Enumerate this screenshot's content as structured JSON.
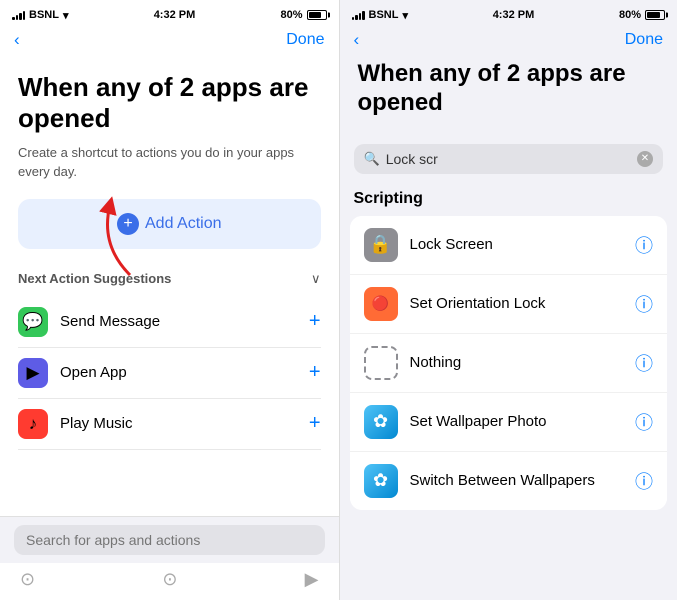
{
  "left_panel": {
    "status": {
      "carrier": "BSNL",
      "time": "4:32 PM",
      "battery": "80%"
    },
    "nav": {
      "back_icon": "‹",
      "done_label": "Done"
    },
    "heading": "When any of 2 apps are opened",
    "subtext": "Create a shortcut to actions you do in your apps every day.",
    "add_action_label": "Add Action",
    "next_section_title": "Next Action Suggestions",
    "actions": [
      {
        "label": "Send Message",
        "icon": "💬",
        "icon_class": "icon-green"
      },
      {
        "label": "Open App",
        "icon": "▶",
        "icon_class": "icon-purple"
      },
      {
        "label": "Play Music",
        "icon": "♪",
        "icon_class": "icon-red"
      }
    ],
    "search_placeholder": "Search for apps and actions"
  },
  "right_panel": {
    "status": {
      "carrier": "BSNL",
      "time": "4:32 PM",
      "battery": "80%"
    },
    "nav": {
      "back_icon": "‹",
      "done_label": "Done"
    },
    "heading": "When any of 2 apps are opened",
    "search_value": "Lock scr",
    "section_title": "Scripting",
    "results": [
      {
        "label": "Lock Screen",
        "icon": "🔒",
        "icon_class": "icon-gray"
      },
      {
        "label": "Set Orientation Lock",
        "icon": "🔴",
        "icon_class": "icon-orange"
      },
      {
        "label": "Nothing",
        "icon": "◻",
        "icon_class": "icon-border"
      },
      {
        "label": "Set Wallpaper Photo",
        "icon": "✿",
        "icon_class": "icon-blue-grad"
      },
      {
        "label": "Switch Between Wallpapers",
        "icon": "✿",
        "icon_class": "icon-blue-grad"
      }
    ]
  }
}
